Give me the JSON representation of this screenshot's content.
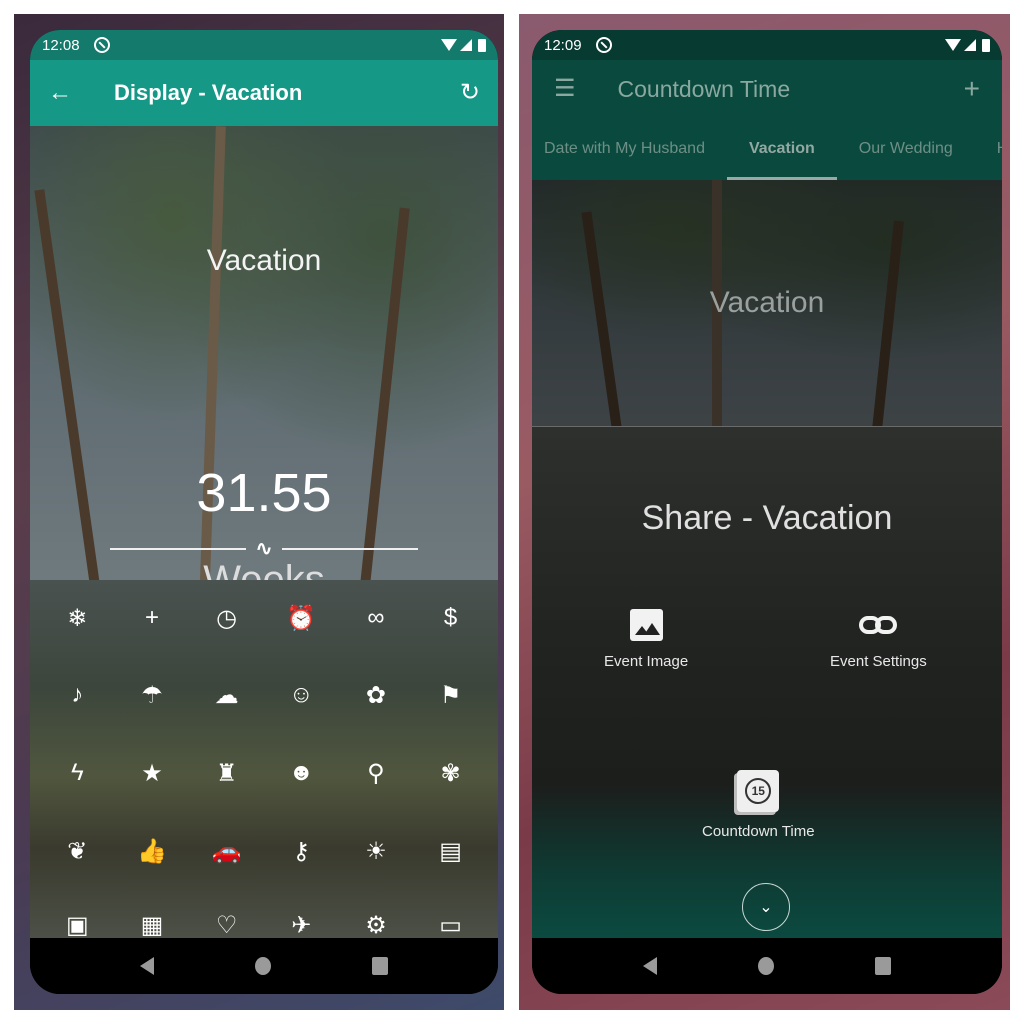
{
  "left_screen": {
    "status_bar": {
      "time": "12:08"
    },
    "app_bar": {
      "back_icon": "arrow-left-icon",
      "title": "Display - Vacation",
      "refresh_icon": "refresh-icon"
    },
    "event": {
      "title": "Vacation",
      "count": "31.55",
      "trend_icon": "trending-icon",
      "unit": "Weeks"
    },
    "icon_grid": {
      "rows": [
        [
          "snowflake",
          "plus",
          "clock",
          "alarm",
          "infinity",
          "dollar"
        ],
        [
          "music-note",
          "beach-umbrella",
          "cloud",
          "face",
          "flower-gear",
          "flag"
        ],
        [
          "flash",
          "star",
          "flashlight",
          "smiley",
          "lightbulb",
          "local-florist"
        ],
        [
          "spa",
          "thumbs-up",
          "car",
          "key",
          "sun",
          "gift-card"
        ],
        [
          "briefcase",
          "calendar",
          "heart",
          "airplane",
          "motorcycle",
          "sofa"
        ]
      ],
      "glyphs": [
        [
          "❄",
          "+",
          "◷",
          "⏰",
          "∞",
          "$"
        ],
        [
          "♪",
          "☂",
          "☁",
          "☺",
          "✿",
          "⚑"
        ],
        [
          "ϟ",
          "★",
          "♜",
          "☻",
          "⚲",
          "✾"
        ],
        [
          "❦",
          "👍",
          "🚗",
          "⚷",
          "☀",
          "▤"
        ],
        [
          "▣",
          "▦",
          "♡",
          "✈",
          "⚙",
          "▭"
        ]
      ]
    },
    "nav": {
      "back": "Back",
      "home": "Home",
      "recents": "Recents"
    }
  },
  "right_screen": {
    "status_bar": {
      "time": "12:09"
    },
    "app_bar": {
      "menu_icon": "hamburger-menu-icon",
      "title": "Countdown Time",
      "add_icon": "plus-icon"
    },
    "tabs": [
      {
        "label": "Date with My Husband",
        "active": false
      },
      {
        "label": "Vacation",
        "active": true
      },
      {
        "label": "Our Wedding",
        "active": false
      },
      {
        "label": "Hiki",
        "active": false
      }
    ],
    "event": {
      "title": "Vacation"
    },
    "share_sheet": {
      "title": "Share - Vacation",
      "options": [
        {
          "label": "Event Image",
          "icon": "image-icon"
        },
        {
          "label": "Event Settings",
          "icon": "link-icon"
        },
        {
          "label": "Countdown Time",
          "icon": "calendar-15-icon",
          "badge": "15"
        }
      ],
      "collapse_icon": "chevron-down-icon"
    },
    "nav": {
      "back": "Back",
      "home": "Home",
      "recents": "Recents"
    }
  },
  "colors": {
    "primary": "#169886",
    "primary_dark": "#137a6c",
    "dimmed_primary": "#0a4a3e"
  }
}
